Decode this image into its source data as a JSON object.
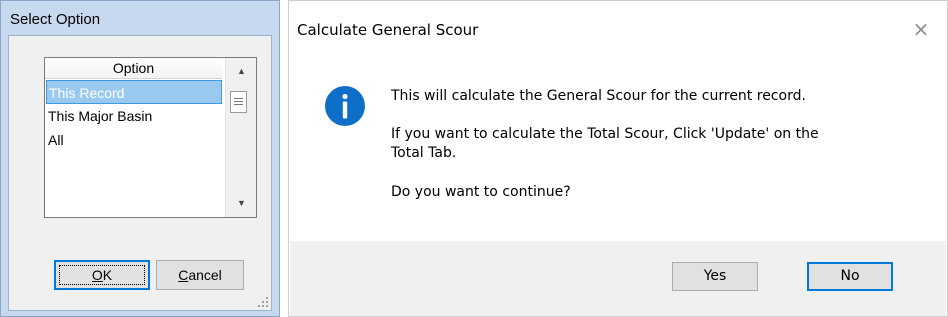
{
  "select_dialog": {
    "title": "Select Option",
    "list_header": "Option",
    "items": [
      {
        "label": "This Record",
        "selected": true
      },
      {
        "label": "This Major Basin",
        "selected": false
      },
      {
        "label": "All",
        "selected": false
      }
    ],
    "ok_mnemonic": "O",
    "ok_rest": "K",
    "cancel_mnemonic": "C",
    "cancel_rest": "ancel"
  },
  "message_box": {
    "title": "Calculate General Scour",
    "close_glyph": "×",
    "icon": "information-icon",
    "line1": "This will calculate the General Scour for the current record.",
    "line2a": "If you want to calculate the Total Scour, Click 'Update' on the",
    "line2b": "Total Tab.",
    "line3": "Do you want to continue?",
    "yes_label": "Yes",
    "no_label": "No"
  },
  "colors": {
    "title_bar": "#c6d9ee",
    "selection": "#99c9ef",
    "accent": "#0078d7",
    "info_icon": "#0e6fc8"
  }
}
